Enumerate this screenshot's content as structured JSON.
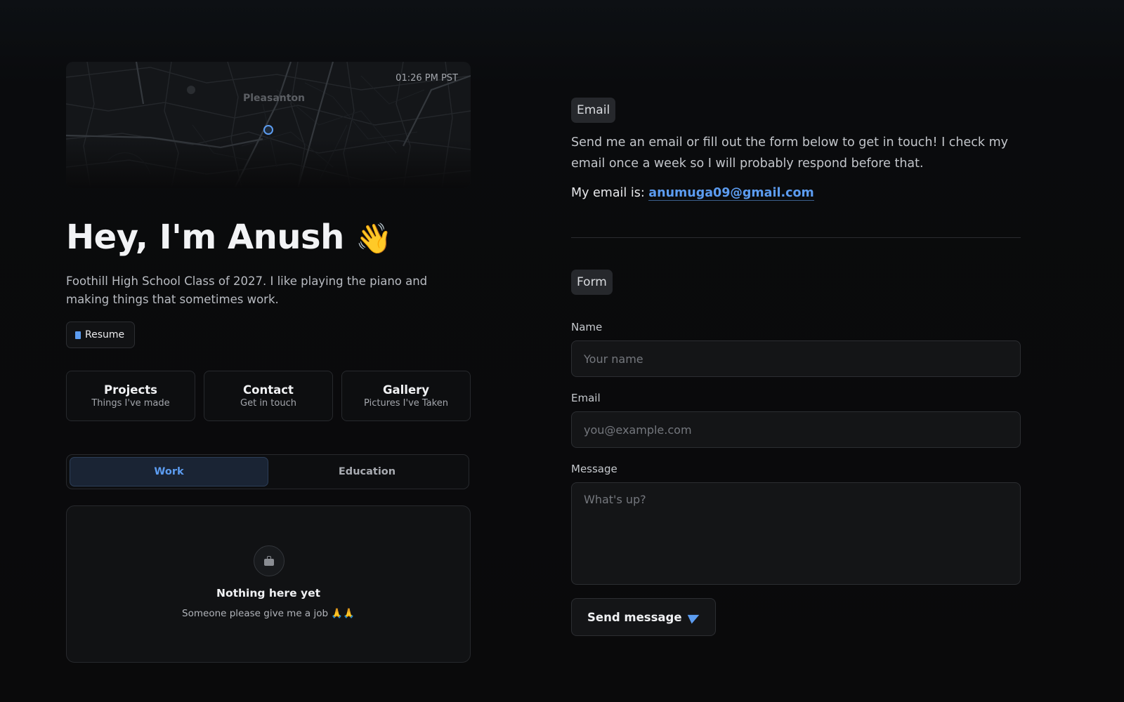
{
  "profile": {
    "map": {
      "time": "01:26 PM PST",
      "city": "Pleasanton"
    },
    "greeting": "Hey, I'm Anush",
    "wave_emoji": "👋",
    "bio": "Foothill High School Class of 2027. I like playing the piano and making things that sometimes work.",
    "resume_label": "Resume"
  },
  "cards": [
    {
      "title": "Projects",
      "subtitle": "Things I've made"
    },
    {
      "title": "Contact",
      "subtitle": "Get in touch"
    },
    {
      "title": "Gallery",
      "subtitle": "Pictures I've Taken"
    }
  ],
  "tabs": {
    "work": "Work",
    "education": "Education",
    "active": "work"
  },
  "empty_state": {
    "icon": "briefcase-icon",
    "title": "Nothing here yet",
    "subtitle": "Someone please give me a job 🙏🙏"
  },
  "contact": {
    "email_badge": "Email",
    "intro": "Send me an email or fill out the form below to get in touch! I check my email once a week so I will probably respond before that.",
    "email_prefix": "My email is:",
    "email_address": "anumuga09@gmail.com",
    "form_badge": "Form",
    "form": {
      "name_label": "Name",
      "name_placeholder": "Your name",
      "email_label": "Email",
      "email_placeholder": "you@example.com",
      "message_label": "Message",
      "message_placeholder": "What's up?",
      "send_label": "Send message"
    }
  },
  "colors": {
    "accent": "#5c9cf0",
    "background": "#0a0a0b",
    "card": "#111214"
  }
}
